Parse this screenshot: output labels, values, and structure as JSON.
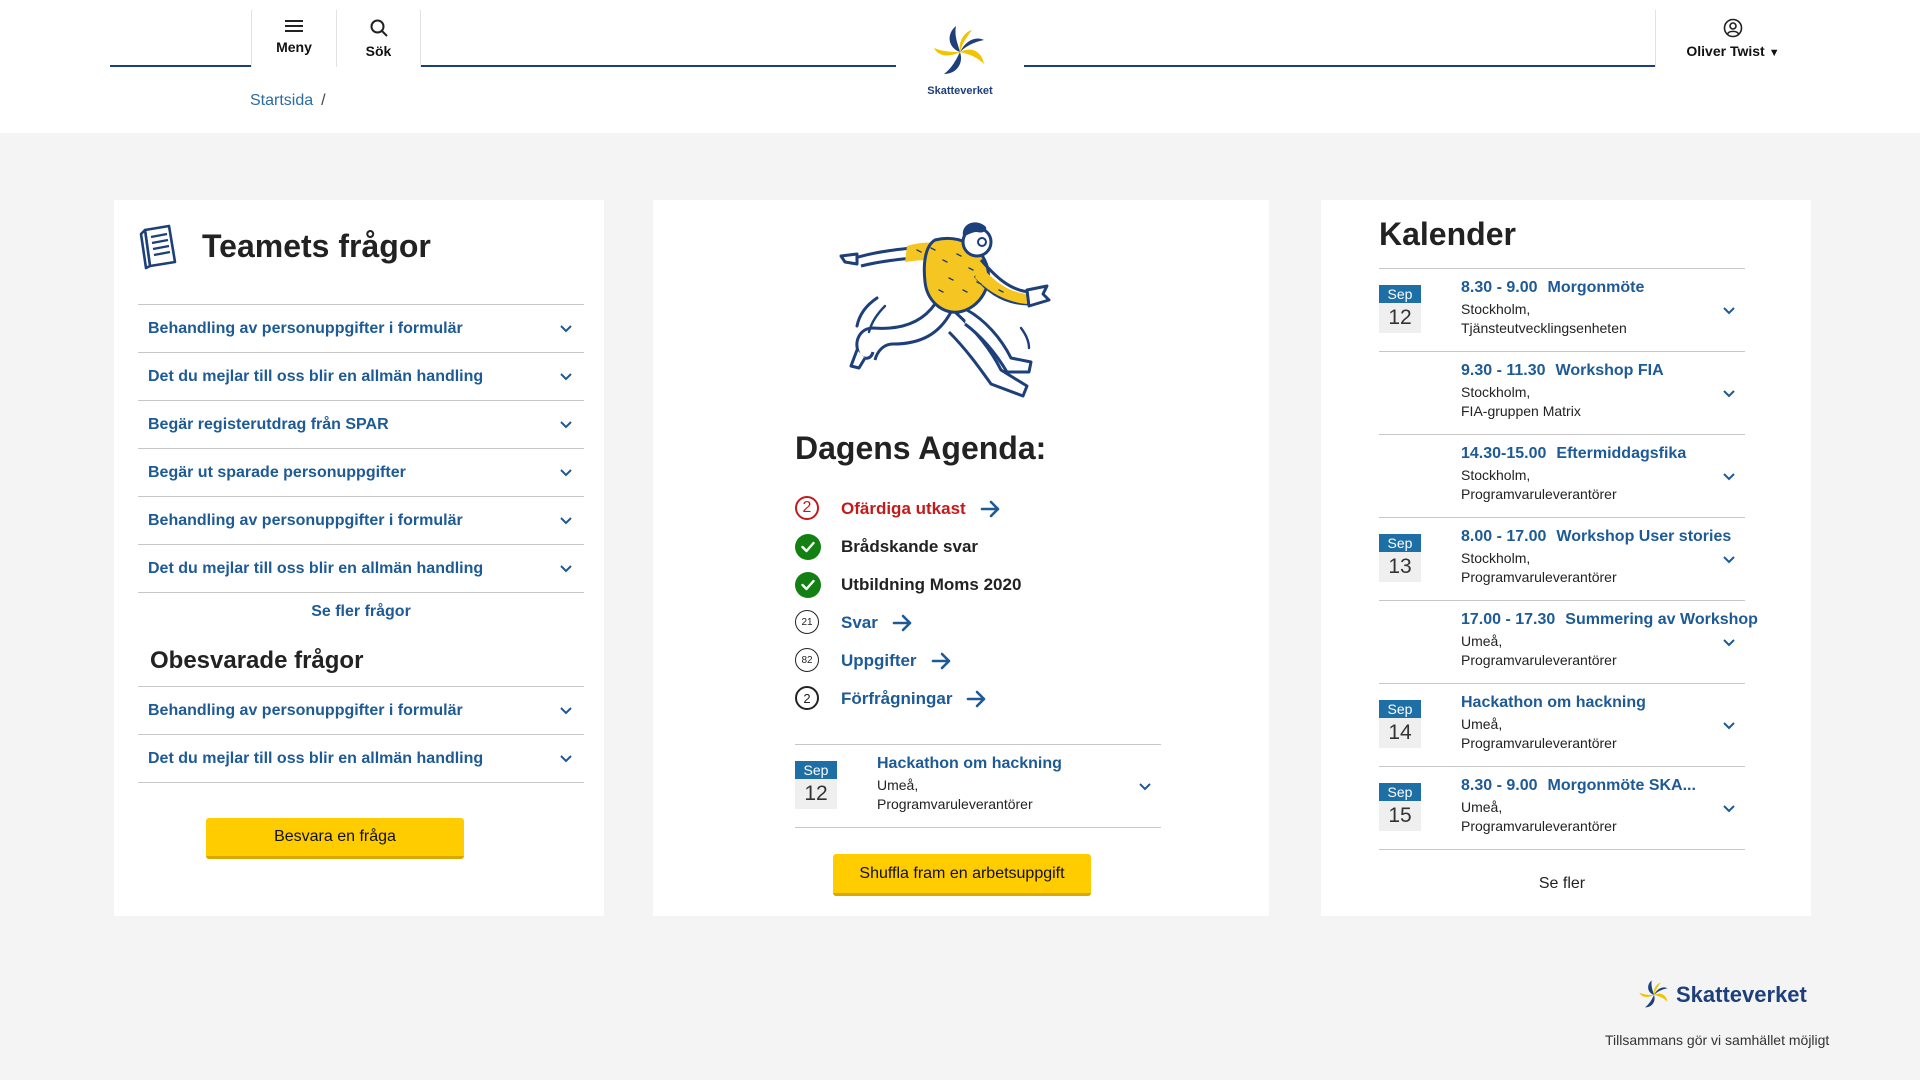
{
  "header": {
    "menu_label": "Meny",
    "search_label": "Sök",
    "user_name": "Oliver Twist",
    "logo_text": "Skatteverket"
  },
  "breadcrumb": {
    "home": "Startsida",
    "separator": "/"
  },
  "team_questions": {
    "title": "Teamets frågor",
    "items": [
      {
        "label": "Behandling av personuppgifter i formulär"
      },
      {
        "label": "Det du mejlar till oss blir en allmän handling"
      },
      {
        "label": "Begär registerutdrag från SPAR"
      },
      {
        "label": "Begär ut sparade personuppgifter"
      },
      {
        "label": "Behandling av personuppgifter i formulär"
      },
      {
        "label": "Det du mejlar till oss blir en allmän handling"
      }
    ],
    "more_label": "Se fler frågor",
    "unanswered_title": "Obesvarade frågor",
    "unanswered_items": [
      {
        "label": "Behandling av personuppgifter i formulär"
      },
      {
        "label": "Det du mejlar till oss blir en allmän handling"
      }
    ],
    "answer_button": "Besvara en fråga"
  },
  "agenda": {
    "title": "Dagens Agenda:",
    "items": [
      {
        "badge": "2",
        "label": "Ofärdiga utkast"
      },
      {
        "label": "Brådskande svar"
      },
      {
        "label": "Utbildning Moms 2020"
      },
      {
        "badge": "21",
        "label": "Svar"
      },
      {
        "badge": "82",
        "label": "Uppgifter"
      },
      {
        "badge": "2",
        "label": "Förfrågningar"
      }
    ],
    "event": {
      "month": "Sep",
      "day": "12",
      "title": "Hackathon om hackning",
      "location": "Umeå,",
      "organizer": "Programvaruleverantörer"
    },
    "shuffle_button": "Shuffla fram en arbetsuppgift"
  },
  "calendar": {
    "title": "Kalender",
    "events": [
      {
        "month": "Sep",
        "day": "12",
        "time": "8.30 - 9.00",
        "title": "Morgonmöte",
        "location": "Stockholm,",
        "organizer": "Tjänsteutvecklingsenheten"
      },
      {
        "month": "",
        "day": "",
        "time": "9.30 - 11.30",
        "title": "Workshop FIA",
        "location": "Stockholm,",
        "organizer": "FIA-gruppen Matrix"
      },
      {
        "month": "",
        "day": "",
        "time": "14.30-15.00",
        "title": "Eftermiddagsfika",
        "location": "Stockholm,",
        "organizer": "Programvaruleverantörer"
      },
      {
        "month": "Sep",
        "day": "13",
        "time": "8.00 - 17.00",
        "title": "Workshop User stories",
        "location": "Stockholm,",
        "organizer": "Programvaruleverantörer"
      },
      {
        "month": "",
        "day": "",
        "time": "17.00 - 17.30",
        "title": "Summering av Workshop",
        "location": "Umeå,",
        "organizer": "Programvaruleverantörer"
      },
      {
        "month": "Sep",
        "day": "14",
        "time": "",
        "title": "Hackathon om hackning",
        "location": "Umeå,",
        "organizer": "Programvaruleverantörer"
      },
      {
        "month": "Sep",
        "day": "15",
        "time": "8.30 - 9.00",
        "title": "Morgonmöte SKA...",
        "location": "Umeå,",
        "organizer": "Programvaruleverantörer"
      }
    ],
    "more_label": "Se fler"
  },
  "footer": {
    "logo_text": "Skatteverket",
    "tagline": "Tillsammans gör vi samhället möjligt"
  },
  "colors": {
    "brand_blue": "#1d3f7a",
    "link_blue": "#1d5a96",
    "accent_yellow": "#ffcc00",
    "alert_red": "#c41a1a",
    "success_green": "#128012"
  }
}
